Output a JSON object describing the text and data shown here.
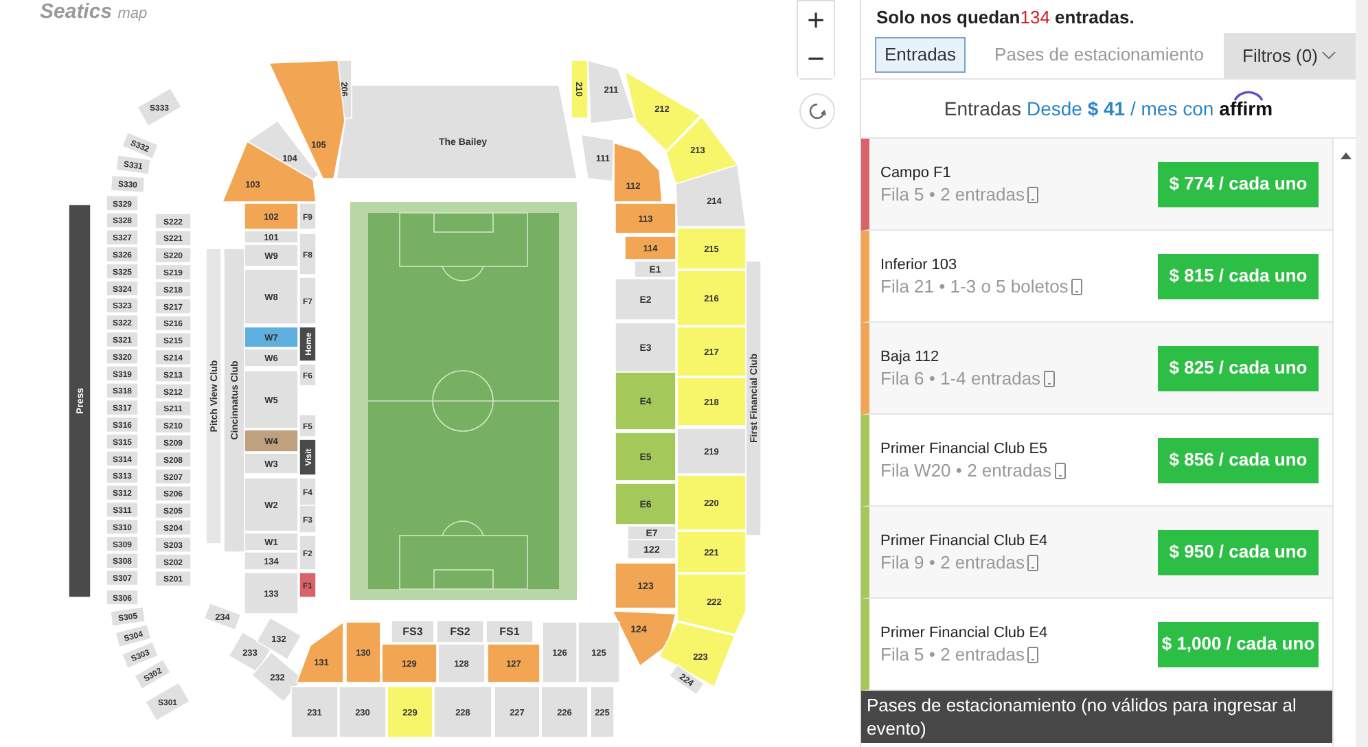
{
  "map": {
    "logo": "Seatics",
    "logo_suffix": "map",
    "zoom_in": "+",
    "zoom_out": "−",
    "outer_sideline": [
      {
        "label": "S333",
        "color": "#e0e0e0"
      },
      {
        "label": "S332",
        "color": "#e0e0e0"
      },
      {
        "label": "S331",
        "color": "#e0e0e0"
      },
      {
        "label": "S330",
        "color": "#e0e0e0"
      },
      {
        "label": "S329",
        "color": "#e0e0e0"
      },
      {
        "label": "S328",
        "color": "#e0e0e0"
      },
      {
        "label": "S327",
        "color": "#e0e0e0"
      },
      {
        "label": "S326",
        "color": "#e0e0e0"
      },
      {
        "label": "S325",
        "color": "#e0e0e0"
      },
      {
        "label": "S324",
        "color": "#e0e0e0"
      },
      {
        "label": "S323",
        "color": "#e0e0e0"
      },
      {
        "label": "S322",
        "color": "#e0e0e0"
      },
      {
        "label": "S321",
        "color": "#e0e0e0"
      },
      {
        "label": "S320",
        "color": "#e0e0e0"
      },
      {
        "label": "S319",
        "color": "#e0e0e0"
      },
      {
        "label": "S318",
        "color": "#e0e0e0"
      },
      {
        "label": "S317",
        "color": "#e0e0e0"
      },
      {
        "label": "S316",
        "color": "#e0e0e0"
      },
      {
        "label": "S315",
        "color": "#e0e0e0"
      },
      {
        "label": "S314",
        "color": "#e0e0e0"
      },
      {
        "label": "S313",
        "color": "#e0e0e0"
      },
      {
        "label": "S312",
        "color": "#e0e0e0"
      },
      {
        "label": "S311",
        "color": "#e0e0e0"
      },
      {
        "label": "S310",
        "color": "#e0e0e0"
      },
      {
        "label": "S309",
        "color": "#e0e0e0"
      },
      {
        "label": "S308",
        "color": "#e0e0e0"
      },
      {
        "label": "S307",
        "color": "#e0e0e0"
      },
      {
        "label": "S306",
        "color": "#e0e0e0"
      },
      {
        "label": "S305",
        "color": "#e0e0e0"
      },
      {
        "label": "S304",
        "color": "#e0e0e0"
      },
      {
        "label": "S303",
        "color": "#e0e0e0"
      },
      {
        "label": "S302",
        "color": "#e0e0e0"
      },
      {
        "label": "S301",
        "color": "#e0e0e0"
      }
    ],
    "inner_sideline": [
      {
        "label": "S222",
        "color": "#e0e0e0"
      },
      {
        "label": "S221",
        "color": "#e0e0e0"
      },
      {
        "label": "S220",
        "color": "#e0e0e0"
      },
      {
        "label": "S219",
        "color": "#e0e0e0"
      },
      {
        "label": "S218",
        "color": "#e0e0e0"
      },
      {
        "label": "S217",
        "color": "#e0e0e0"
      },
      {
        "label": "S216",
        "color": "#e0e0e0"
      },
      {
        "label": "S215",
        "color": "#e0e0e0"
      },
      {
        "label": "S214",
        "color": "#e0e0e0"
      },
      {
        "label": "S213",
        "color": "#e0e0e0"
      },
      {
        "label": "S212",
        "color": "#e0e0e0"
      },
      {
        "label": "S211",
        "color": "#e0e0e0"
      },
      {
        "label": "S210",
        "color": "#e0e0e0"
      },
      {
        "label": "S209",
        "color": "#e0e0e0"
      },
      {
        "label": "S208",
        "color": "#e0e0e0"
      },
      {
        "label": "S207",
        "color": "#e0e0e0"
      },
      {
        "label": "S206",
        "color": "#e0e0e0"
      },
      {
        "label": "S205",
        "color": "#e0e0e0"
      },
      {
        "label": "S204",
        "color": "#e0e0e0"
      },
      {
        "label": "S203",
        "color": "#e0e0e0"
      },
      {
        "label": "S202",
        "color": "#e0e0e0"
      },
      {
        "label": "S201",
        "color": "#e0e0e0"
      }
    ],
    "areas": [
      {
        "label": "Press",
        "color": "#4a4a4a"
      },
      {
        "label": "Pitch View Club",
        "color": "#e6e6e6"
      },
      {
        "label": "Cincinnatus Club",
        "color": "#e0e0e0"
      },
      {
        "label": "First Financial Club",
        "color": "#e0e0e0"
      },
      {
        "label": "The Bailey",
        "color": "#e0e0e0"
      }
    ],
    "west_stand": [
      {
        "label": "102",
        "color": "#f2a654"
      },
      {
        "label": "101",
        "color": "#e0e0e0"
      },
      {
        "label": "W9",
        "color": "#e0e0e0"
      },
      {
        "label": "W8",
        "color": "#e0e0e0"
      },
      {
        "label": "W7",
        "color": "#5fb0de"
      },
      {
        "label": "W6",
        "color": "#e0e0e0"
      },
      {
        "label": "W5",
        "color": "#e0e0e0"
      },
      {
        "label": "W4",
        "color": "#bfa07f"
      },
      {
        "label": "W3",
        "color": "#e0e0e0"
      },
      {
        "label": "W2",
        "color": "#e0e0e0"
      },
      {
        "label": "W1",
        "color": "#e0e0e0"
      },
      {
        "label": "134",
        "color": "#e0e0e0"
      },
      {
        "label": "133",
        "color": "#e0e0e0"
      }
    ],
    "west_field": [
      {
        "label": "F9",
        "color": "#e0e0e0"
      },
      {
        "label": "F8",
        "color": "#e0e0e0"
      },
      {
        "label": "F7",
        "color": "#e0e0e0"
      },
      {
        "label": "Home",
        "color": "#4a4a4a"
      },
      {
        "label": "F6",
        "color": "#e0e0e0"
      },
      {
        "label": "F5",
        "color": "#e0e0e0"
      },
      {
        "label": "Visit",
        "color": "#4a4a4a"
      },
      {
        "label": "F4",
        "color": "#e0e0e0"
      },
      {
        "label": "F3",
        "color": "#e0e0e0"
      },
      {
        "label": "F2",
        "color": "#e0e0e0"
      },
      {
        "label": "F1",
        "color": "#d9636b"
      }
    ],
    "north_west": [
      {
        "label": "206",
        "color": "#e0e0e0"
      },
      {
        "label": "105",
        "color": "#f2a654"
      },
      {
        "label": "104",
        "color": "#e0e0e0"
      },
      {
        "label": "103",
        "color": "#f2a654"
      }
    ],
    "north_east": [
      {
        "label": "210",
        "color": "#f7f56a"
      },
      {
        "label": "211",
        "color": "#e0e0e0"
      },
      {
        "label": "212",
        "color": "#f7f56a"
      },
      {
        "label": "213",
        "color": "#f7f56a"
      },
      {
        "label": "214",
        "color": "#e0e0e0"
      },
      {
        "label": "111",
        "color": "#e0e0e0"
      },
      {
        "label": "112",
        "color": "#f2a654"
      },
      {
        "label": "113",
        "color": "#f2a654"
      },
      {
        "label": "114",
        "color": "#f2a654"
      }
    ],
    "east_stand": [
      {
        "label": "E1",
        "color": "#e0e0e0"
      },
      {
        "label": "E2",
        "color": "#e0e0e0"
      },
      {
        "label": "E3",
        "color": "#e0e0e0"
      },
      {
        "label": "E4",
        "color": "#a5c85a"
      },
      {
        "label": "E5",
        "color": "#a5c85a"
      },
      {
        "label": "E6",
        "color": "#a5c85a"
      },
      {
        "label": "E7",
        "color": "#e0e0e0"
      },
      {
        "label": "122",
        "color": "#e0e0e0"
      },
      {
        "label": "123",
        "color": "#f2a654"
      },
      {
        "label": "124",
        "color": "#f2a654"
      }
    ],
    "east_upper": [
      {
        "label": "215",
        "color": "#f7f56a"
      },
      {
        "label": "216",
        "color": "#f7f56a"
      },
      {
        "label": "217",
        "color": "#f7f56a"
      },
      {
        "label": "218",
        "color": "#f7f56a"
      },
      {
        "label": "219",
        "color": "#e0e0e0"
      },
      {
        "label": "220",
        "color": "#f7f56a"
      },
      {
        "label": "221",
        "color": "#f7f56a"
      },
      {
        "label": "222",
        "color": "#f7f56a"
      },
      {
        "label": "223",
        "color": "#f7f56a"
      },
      {
        "label": "224",
        "color": "#e0e0e0"
      }
    ],
    "south_west": [
      {
        "label": "234",
        "color": "#e0e0e0"
      },
      {
        "label": "233",
        "color": "#e0e0e0"
      },
      {
        "label": "132",
        "color": "#e0e0e0"
      },
      {
        "label": "232",
        "color": "#e0e0e0"
      }
    ],
    "south_field": [
      {
        "label": "FS3",
        "color": "#e0e0e0"
      },
      {
        "label": "FS2",
        "color": "#e0e0e0"
      },
      {
        "label": "FS1",
        "color": "#e0e0e0"
      }
    ],
    "south_lower": [
      {
        "label": "131",
        "color": "#f2a654"
      },
      {
        "label": "130",
        "color": "#f2a654"
      },
      {
        "label": "129",
        "color": "#f2a654"
      },
      {
        "label": "128",
        "color": "#e0e0e0"
      },
      {
        "label": "127",
        "color": "#f2a654"
      },
      {
        "label": "126",
        "color": "#e0e0e0"
      },
      {
        "label": "125",
        "color": "#e0e0e0"
      }
    ],
    "south_upper": [
      {
        "label": "231",
        "color": "#e0e0e0"
      },
      {
        "label": "230",
        "color": "#e0e0e0"
      },
      {
        "label": "229",
        "color": "#f7f56a"
      },
      {
        "label": "228",
        "color": "#e0e0e0"
      },
      {
        "label": "227",
        "color": "#e0e0e0"
      },
      {
        "label": "226",
        "color": "#e0e0e0"
      },
      {
        "label": "225",
        "color": "#e0e0e0"
      }
    ]
  },
  "panel": {
    "remaining_prefix": "Solo nos quedan",
    "remaining_count": "134",
    "remaining_suffix": "entradas.",
    "tabs": [
      {
        "label": "Entradas",
        "selected": true
      },
      {
        "label": "Pases de estacionamiento",
        "selected": false
      }
    ],
    "filter": "Filtros (0)",
    "affirm": {
      "label": "Entradas",
      "prefix": "Desde",
      "amount": "$ 41",
      "suffix": "/ mes con",
      "brand": "affirm"
    },
    "listings": [
      {
        "title": "Campo F1",
        "detail": "Fila 5 • 2 entradas",
        "price": "$ 774 / cada uno",
        "color": "#d9636b"
      },
      {
        "title": "Inferior 103",
        "detail": "Fila 21 • 1-3 o 5 boletos",
        "price": "$ 815 / cada uno",
        "color": "#f2a654"
      },
      {
        "title": "Baja 112",
        "detail": "Fila 6 • 1-4 entradas",
        "price": "$ 825 / cada uno",
        "color": "#f2a654"
      },
      {
        "title": "Primer Financial Club E5",
        "detail": "Fila W20 • 2 entradas",
        "price": "$ 856 / cada uno",
        "color": "#a5c85a"
      },
      {
        "title": "Primer Financial Club E4",
        "detail": "Fila 9 • 2 entradas",
        "price": "$ 950 / cada uno",
        "color": "#a5c85a"
      },
      {
        "title": "Primer Financial Club E4",
        "detail": "Fila 5 • 2 entradas",
        "price": "$ 1,000 / cada uno",
        "color": "#a5c85a"
      }
    ],
    "parking_header": "Pases de estacionamiento (no válidos para ingresar al evento)"
  }
}
